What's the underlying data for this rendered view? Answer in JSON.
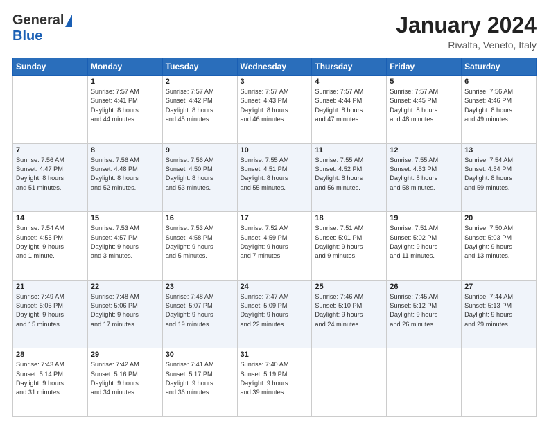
{
  "header": {
    "logo_general": "General",
    "logo_blue": "Blue",
    "month_title": "January 2024",
    "location": "Rivalta, Veneto, Italy"
  },
  "weekdays": [
    "Sunday",
    "Monday",
    "Tuesday",
    "Wednesday",
    "Thursday",
    "Friday",
    "Saturday"
  ],
  "weeks": [
    [
      {
        "day": "",
        "content": ""
      },
      {
        "day": "1",
        "content": "Sunrise: 7:57 AM\nSunset: 4:41 PM\nDaylight: 8 hours\nand 44 minutes."
      },
      {
        "day": "2",
        "content": "Sunrise: 7:57 AM\nSunset: 4:42 PM\nDaylight: 8 hours\nand 45 minutes."
      },
      {
        "day": "3",
        "content": "Sunrise: 7:57 AM\nSunset: 4:43 PM\nDaylight: 8 hours\nand 46 minutes."
      },
      {
        "day": "4",
        "content": "Sunrise: 7:57 AM\nSunset: 4:44 PM\nDaylight: 8 hours\nand 47 minutes."
      },
      {
        "day": "5",
        "content": "Sunrise: 7:57 AM\nSunset: 4:45 PM\nDaylight: 8 hours\nand 48 minutes."
      },
      {
        "day": "6",
        "content": "Sunrise: 7:56 AM\nSunset: 4:46 PM\nDaylight: 8 hours\nand 49 minutes."
      }
    ],
    [
      {
        "day": "7",
        "content": "Sunrise: 7:56 AM\nSunset: 4:47 PM\nDaylight: 8 hours\nand 51 minutes."
      },
      {
        "day": "8",
        "content": "Sunrise: 7:56 AM\nSunset: 4:48 PM\nDaylight: 8 hours\nand 52 minutes."
      },
      {
        "day": "9",
        "content": "Sunrise: 7:56 AM\nSunset: 4:50 PM\nDaylight: 8 hours\nand 53 minutes."
      },
      {
        "day": "10",
        "content": "Sunrise: 7:55 AM\nSunset: 4:51 PM\nDaylight: 8 hours\nand 55 minutes."
      },
      {
        "day": "11",
        "content": "Sunrise: 7:55 AM\nSunset: 4:52 PM\nDaylight: 8 hours\nand 56 minutes."
      },
      {
        "day": "12",
        "content": "Sunrise: 7:55 AM\nSunset: 4:53 PM\nDaylight: 8 hours\nand 58 minutes."
      },
      {
        "day": "13",
        "content": "Sunrise: 7:54 AM\nSunset: 4:54 PM\nDaylight: 8 hours\nand 59 minutes."
      }
    ],
    [
      {
        "day": "14",
        "content": "Sunrise: 7:54 AM\nSunset: 4:55 PM\nDaylight: 9 hours\nand 1 minute."
      },
      {
        "day": "15",
        "content": "Sunrise: 7:53 AM\nSunset: 4:57 PM\nDaylight: 9 hours\nand 3 minutes."
      },
      {
        "day": "16",
        "content": "Sunrise: 7:53 AM\nSunset: 4:58 PM\nDaylight: 9 hours\nand 5 minutes."
      },
      {
        "day": "17",
        "content": "Sunrise: 7:52 AM\nSunset: 4:59 PM\nDaylight: 9 hours\nand 7 minutes."
      },
      {
        "day": "18",
        "content": "Sunrise: 7:51 AM\nSunset: 5:01 PM\nDaylight: 9 hours\nand 9 minutes."
      },
      {
        "day": "19",
        "content": "Sunrise: 7:51 AM\nSunset: 5:02 PM\nDaylight: 9 hours\nand 11 minutes."
      },
      {
        "day": "20",
        "content": "Sunrise: 7:50 AM\nSunset: 5:03 PM\nDaylight: 9 hours\nand 13 minutes."
      }
    ],
    [
      {
        "day": "21",
        "content": "Sunrise: 7:49 AM\nSunset: 5:05 PM\nDaylight: 9 hours\nand 15 minutes."
      },
      {
        "day": "22",
        "content": "Sunrise: 7:48 AM\nSunset: 5:06 PM\nDaylight: 9 hours\nand 17 minutes."
      },
      {
        "day": "23",
        "content": "Sunrise: 7:48 AM\nSunset: 5:07 PM\nDaylight: 9 hours\nand 19 minutes."
      },
      {
        "day": "24",
        "content": "Sunrise: 7:47 AM\nSunset: 5:09 PM\nDaylight: 9 hours\nand 22 minutes."
      },
      {
        "day": "25",
        "content": "Sunrise: 7:46 AM\nSunset: 5:10 PM\nDaylight: 9 hours\nand 24 minutes."
      },
      {
        "day": "26",
        "content": "Sunrise: 7:45 AM\nSunset: 5:12 PM\nDaylight: 9 hours\nand 26 minutes."
      },
      {
        "day": "27",
        "content": "Sunrise: 7:44 AM\nSunset: 5:13 PM\nDaylight: 9 hours\nand 29 minutes."
      }
    ],
    [
      {
        "day": "28",
        "content": "Sunrise: 7:43 AM\nSunset: 5:14 PM\nDaylight: 9 hours\nand 31 minutes."
      },
      {
        "day": "29",
        "content": "Sunrise: 7:42 AM\nSunset: 5:16 PM\nDaylight: 9 hours\nand 34 minutes."
      },
      {
        "day": "30",
        "content": "Sunrise: 7:41 AM\nSunset: 5:17 PM\nDaylight: 9 hours\nand 36 minutes."
      },
      {
        "day": "31",
        "content": "Sunrise: 7:40 AM\nSunset: 5:19 PM\nDaylight: 9 hours\nand 39 minutes."
      },
      {
        "day": "",
        "content": ""
      },
      {
        "day": "",
        "content": ""
      },
      {
        "day": "",
        "content": ""
      }
    ]
  ]
}
